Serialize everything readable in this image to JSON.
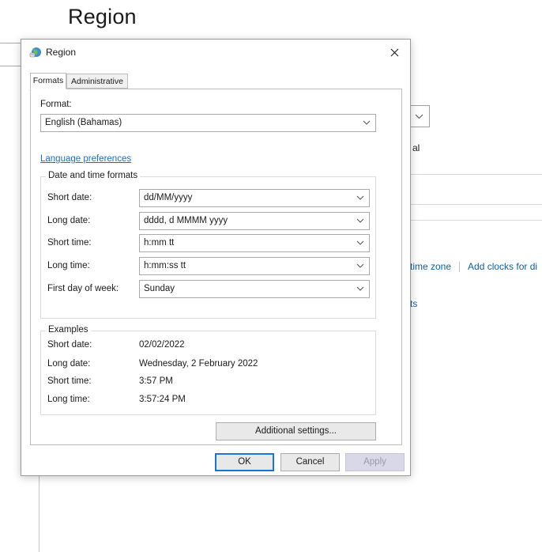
{
  "background": {
    "page_title": "Region",
    "fragment_text": "al",
    "links": [
      "time zone",
      "Add clocks for di"
    ],
    "fragment_link": "ts"
  },
  "dialog": {
    "title": "Region",
    "tabs": [
      {
        "label": "Formats",
        "active": true
      },
      {
        "label": "Administrative",
        "active": false
      }
    ],
    "format_label": "Format:",
    "format_value": "English (Bahamas)",
    "language_link": "Language preferences",
    "datetime_group_title": "Date and time formats",
    "datetime_rows": [
      {
        "label": "Short date:",
        "value": "dd/MM/yyyy"
      },
      {
        "label": "Long date:",
        "value": "dddd, d MMMM yyyy"
      },
      {
        "label": "Short time:",
        "value": "h:mm tt"
      },
      {
        "label": "Long time:",
        "value": "h:mm:ss tt"
      },
      {
        "label": "First day of week:",
        "value": "Sunday"
      }
    ],
    "examples_group_title": "Examples",
    "examples": [
      {
        "label": "Short date:",
        "value": "02/02/2022"
      },
      {
        "label": "Long date:",
        "value": "Wednesday, 2 February 2022"
      },
      {
        "label": "Short time:",
        "value": "3:57 PM"
      },
      {
        "label": "Long time:",
        "value": "3:57:24 PM"
      }
    ],
    "additional_settings_label": "Additional settings...",
    "ok_label": "OK",
    "cancel_label": "Cancel",
    "apply_label": "Apply"
  },
  "colors": {
    "accent": "#1a75d0",
    "link": "#1a6fc5",
    "border": "#a9a9a9"
  },
  "icons": {
    "app": "region-globe-icon",
    "close": "close-icon",
    "dropdown": "chevron-down-icon"
  }
}
